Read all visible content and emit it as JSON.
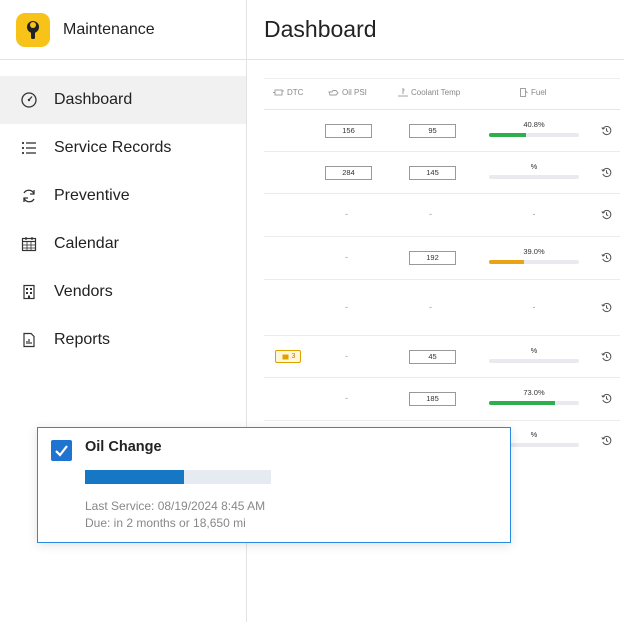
{
  "app": {
    "title": "Maintenance",
    "logo_icon": "wrench-icon",
    "accent": "#f7c318"
  },
  "sidebar": {
    "items": [
      {
        "label": "Dashboard",
        "icon": "gauge-icon",
        "active": true
      },
      {
        "label": "Service Records",
        "icon": "list-icon"
      },
      {
        "label": "Preventive",
        "icon": "refresh-icon"
      },
      {
        "label": "Calendar",
        "icon": "calendar-icon"
      },
      {
        "label": "Vendors",
        "icon": "building-icon"
      },
      {
        "label": "Reports",
        "icon": "report-icon"
      }
    ]
  },
  "page": {
    "title": "Dashboard"
  },
  "table": {
    "headers": {
      "dtc": "DTC",
      "oil": "Oil PSI",
      "coolant": "Coolant Temp",
      "fuel": "Fuel"
    },
    "rows": [
      {
        "dtc": "",
        "oil": "156",
        "coolant": "95",
        "fuel_label": "40.8%",
        "fuel_value": 40.8,
        "fuel_color": "#2eae4f"
      },
      {
        "dtc": "",
        "oil": "284",
        "coolant": "145",
        "fuel_label": "%",
        "fuel_value": 0,
        "fuel_color": "#2eae4f"
      },
      {
        "dtc": "",
        "oil": "-",
        "coolant": "-",
        "fuel_label": "-",
        "fuel_value": null,
        "fuel_color": ""
      },
      {
        "dtc": "",
        "oil": "-",
        "coolant": "192",
        "fuel_label": "39.0%",
        "fuel_value": 39.0,
        "fuel_color": "#e8a317"
      },
      {
        "dtc": "",
        "oil": "-",
        "coolant": "-",
        "fuel_label": "-",
        "fuel_value": null,
        "fuel_color": ""
      },
      {
        "dtc": "3",
        "oil": "-",
        "coolant": "45",
        "fuel_label": "%",
        "fuel_value": 0,
        "fuel_color": "#2eae4f"
      },
      {
        "dtc": "",
        "oil": "-",
        "coolant": "185",
        "fuel_label": "73.0%",
        "fuel_value": 73.0,
        "fuel_color": "#2eae4f"
      },
      {
        "dtc": "",
        "oil": "",
        "coolant": "",
        "fuel_label": "%",
        "fuel_value": 0,
        "fuel_color": "#2eae4f"
      }
    ]
  },
  "card": {
    "title": "Oil Change",
    "checked": true,
    "progress": 0.53,
    "last_service": "Last Service: 08/19/2024 8:45 AM",
    "due": "Due: in 2 months or 18,650 mi",
    "accent": "#1678c4"
  }
}
